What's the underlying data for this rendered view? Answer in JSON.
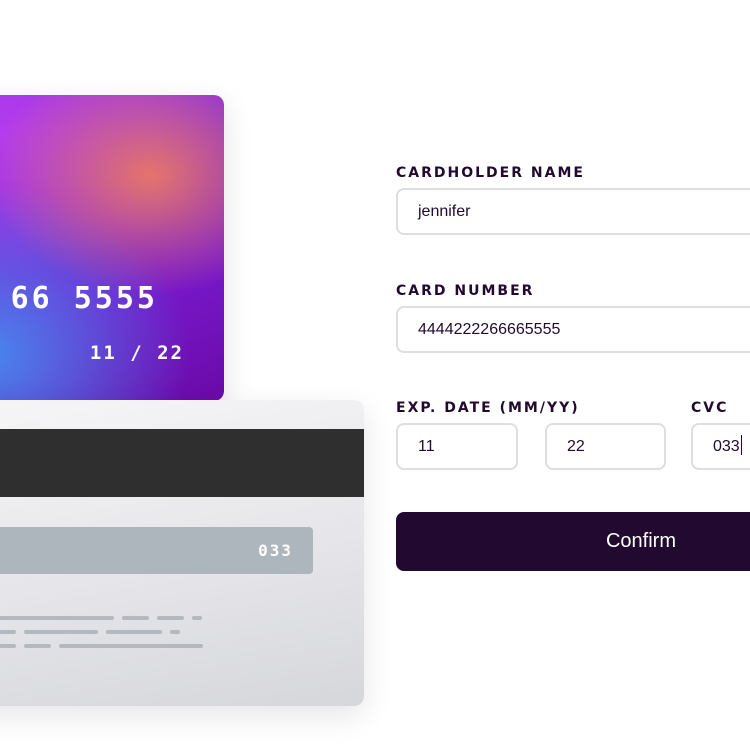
{
  "card_front": {
    "number_display": "66 5555",
    "exp_display": "11 / 22"
  },
  "card_back": {
    "cvc_display": "033"
  },
  "form": {
    "cardholder_label": "CARDHOLDER NAME",
    "cardholder_value": "jennifer",
    "card_number_label": "CARD NUMBER",
    "card_number_value": "4444222266665555",
    "exp_label": "EXP. DATE (MM/YY)",
    "exp_month_value": "11",
    "exp_year_value": "22",
    "cvc_label": "CVC",
    "cvc_value": "033",
    "confirm_label": "Confirm"
  },
  "colors": {
    "primary_dark": "#21092f",
    "input_border": "#dedddf",
    "card_back_stripe": "#2f2f2f"
  }
}
